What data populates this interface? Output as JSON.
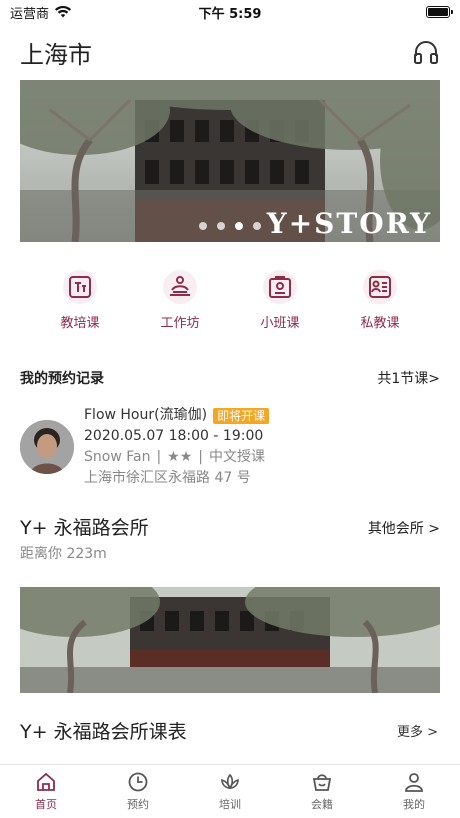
{
  "status_bar": {
    "carrier": "运营商",
    "time": "下午 5:59"
  },
  "header": {
    "city": "上海市",
    "icon": "headphone-icon"
  },
  "banner": {
    "caption": "Y+STORY",
    "dot_count": 4,
    "active_dot": 3
  },
  "categories": [
    {
      "label": "教培课",
      "icon": "teacher-training-icon"
    },
    {
      "label": "工作坊",
      "icon": "workshop-icon"
    },
    {
      "label": "小班课",
      "icon": "small-class-icon"
    },
    {
      "label": "私教课",
      "icon": "private-coach-icon"
    }
  ],
  "booking_section": {
    "title": "我的预约记录",
    "count_label": "共1节课>"
  },
  "booking": {
    "course": "Flow Hour(流瑜伽)",
    "badge": "即将开课",
    "time": "2020.05.07 18:00 - 19:00",
    "teacher": "Snow Fan",
    "level": "★★",
    "language": "中文授课",
    "address": "上海市徐汇区永福路 47 号"
  },
  "club": {
    "name": "Y+ 永福路会所",
    "other_label": "其他会所 >",
    "distance": "距离你 223m"
  },
  "schedule": {
    "title": "Y+ 永福路会所课表",
    "more_label": "更多 >"
  },
  "tabbar": {
    "active": 0,
    "items": [
      {
        "label": "首页",
        "icon": "home-icon"
      },
      {
        "label": "预约",
        "icon": "clock-icon"
      },
      {
        "label": "培训",
        "icon": "lotus-icon"
      },
      {
        "label": "会籍",
        "icon": "basket-icon"
      },
      {
        "label": "我的",
        "icon": "profile-icon"
      }
    ]
  },
  "colors": {
    "accent": "#8e2c4a",
    "badge": "#f5a623"
  }
}
